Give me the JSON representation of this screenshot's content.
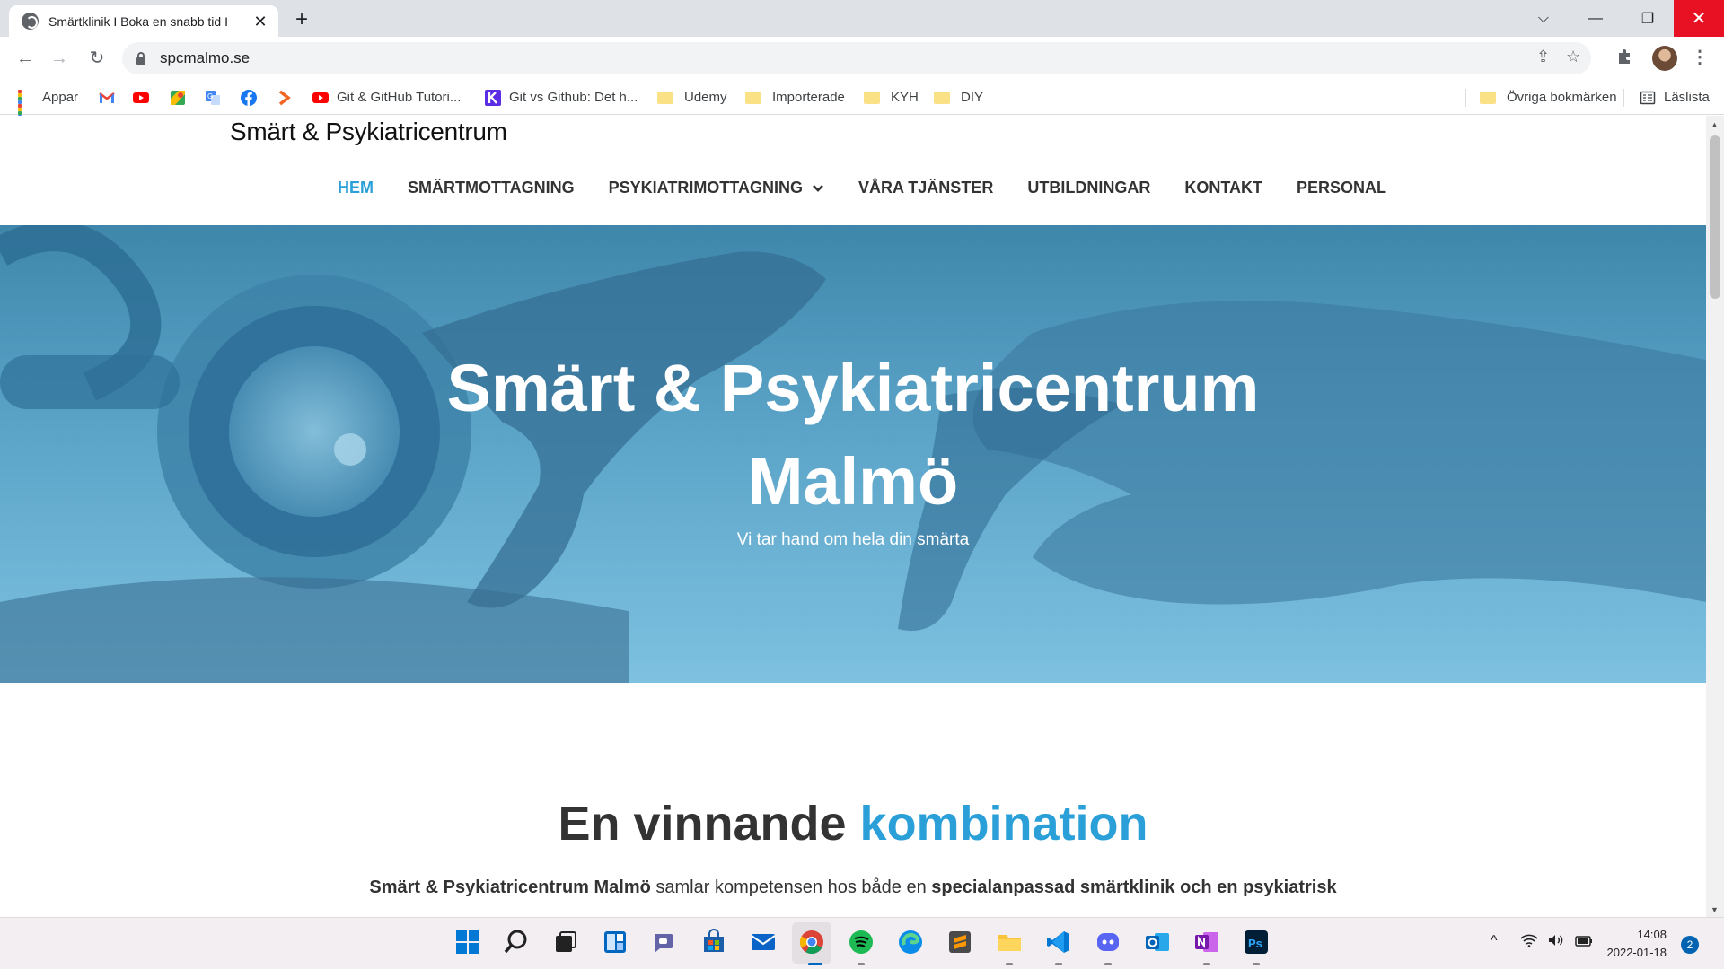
{
  "browser": {
    "tab_title": "Smärtklinik I Boka en snabb tid I",
    "tab_close": "✕",
    "new_tab": "+",
    "url": "spcmalmo.se",
    "window_controls": {
      "tab_list": "⌵",
      "minimize": "—",
      "maximize": "❐",
      "close": "✕"
    },
    "nav": {
      "back": "←",
      "forward": "→",
      "reload": "↻"
    },
    "omnibox_icons": {
      "share": "⇪",
      "star": "☆"
    },
    "extensions_icon": "puzzle-icon",
    "menu": "⋮"
  },
  "bookmarks": {
    "items": [
      {
        "label": "Appar",
        "icon": "apps-grid-icon"
      },
      {
        "label": "",
        "icon": "gmail-icon"
      },
      {
        "label": "",
        "icon": "youtube-icon"
      },
      {
        "label": "",
        "icon": "maps-icon"
      },
      {
        "label": "",
        "icon": "translate-icon"
      },
      {
        "label": "",
        "icon": "facebook-icon"
      },
      {
        "label": "",
        "icon": "chevron-orange-icon"
      },
      {
        "label": "Git & GitHub Tutori...",
        "icon": "youtube-icon"
      },
      {
        "label": "Git vs Github: Det h...",
        "icon": "k-icon"
      },
      {
        "label": "Udemy",
        "icon": "folder-icon"
      },
      {
        "label": "Importerade",
        "icon": "folder-icon"
      },
      {
        "label": "KYH",
        "icon": "folder-icon"
      },
      {
        "label": "DIY",
        "icon": "folder-icon"
      }
    ],
    "other": "Övriga bokmärken",
    "reading_list": "Läslista"
  },
  "site": {
    "logo": "Smärt & Psykiatricentrum",
    "nav": [
      {
        "label": "HEM",
        "active": true
      },
      {
        "label": "SMÄRTMOTTAGNING"
      },
      {
        "label": "PSYKIATRIMOTTAGNING",
        "dropdown": "⌄"
      },
      {
        "label": "VÅRA TJÄNSTER"
      },
      {
        "label": "UTBILDNINGAR"
      },
      {
        "label": "KONTAKT"
      },
      {
        "label": "PERSONAL"
      }
    ],
    "hero": {
      "title_line1": "Smärt & Psykiatricentrum",
      "title_line2": "Malmö",
      "subtitle": "Vi tar hand om hela din smärta"
    },
    "section": {
      "heading_plain": "En vinnande",
      "heading_accent": "kombination",
      "intro_bold1": "Smärt & Psykiatricentrum Malmö",
      "intro_plain": " samlar kompetensen hos både en ",
      "intro_bold2": "specialanpassad smärtklinik och en psykiatrisk"
    },
    "colors": {
      "accent": "#2a9fd8",
      "text": "#333333",
      "hero": "#5ba4c8"
    }
  },
  "taskbar": {
    "icons": [
      "windows-start-icon",
      "search-icon",
      "task-view-icon",
      "widgets-icon",
      "teams-chat-icon",
      "store-icon",
      "mail-icon",
      "chrome-icon",
      "spotify-icon",
      "edge-icon",
      "sublime-icon",
      "file-explorer-icon",
      "vscode-icon",
      "discord-icon",
      "outlook-icon",
      "onenote-icon",
      "photoshop-icon"
    ],
    "time": "14:08",
    "date": "2022-01-18",
    "notifications": "2"
  }
}
